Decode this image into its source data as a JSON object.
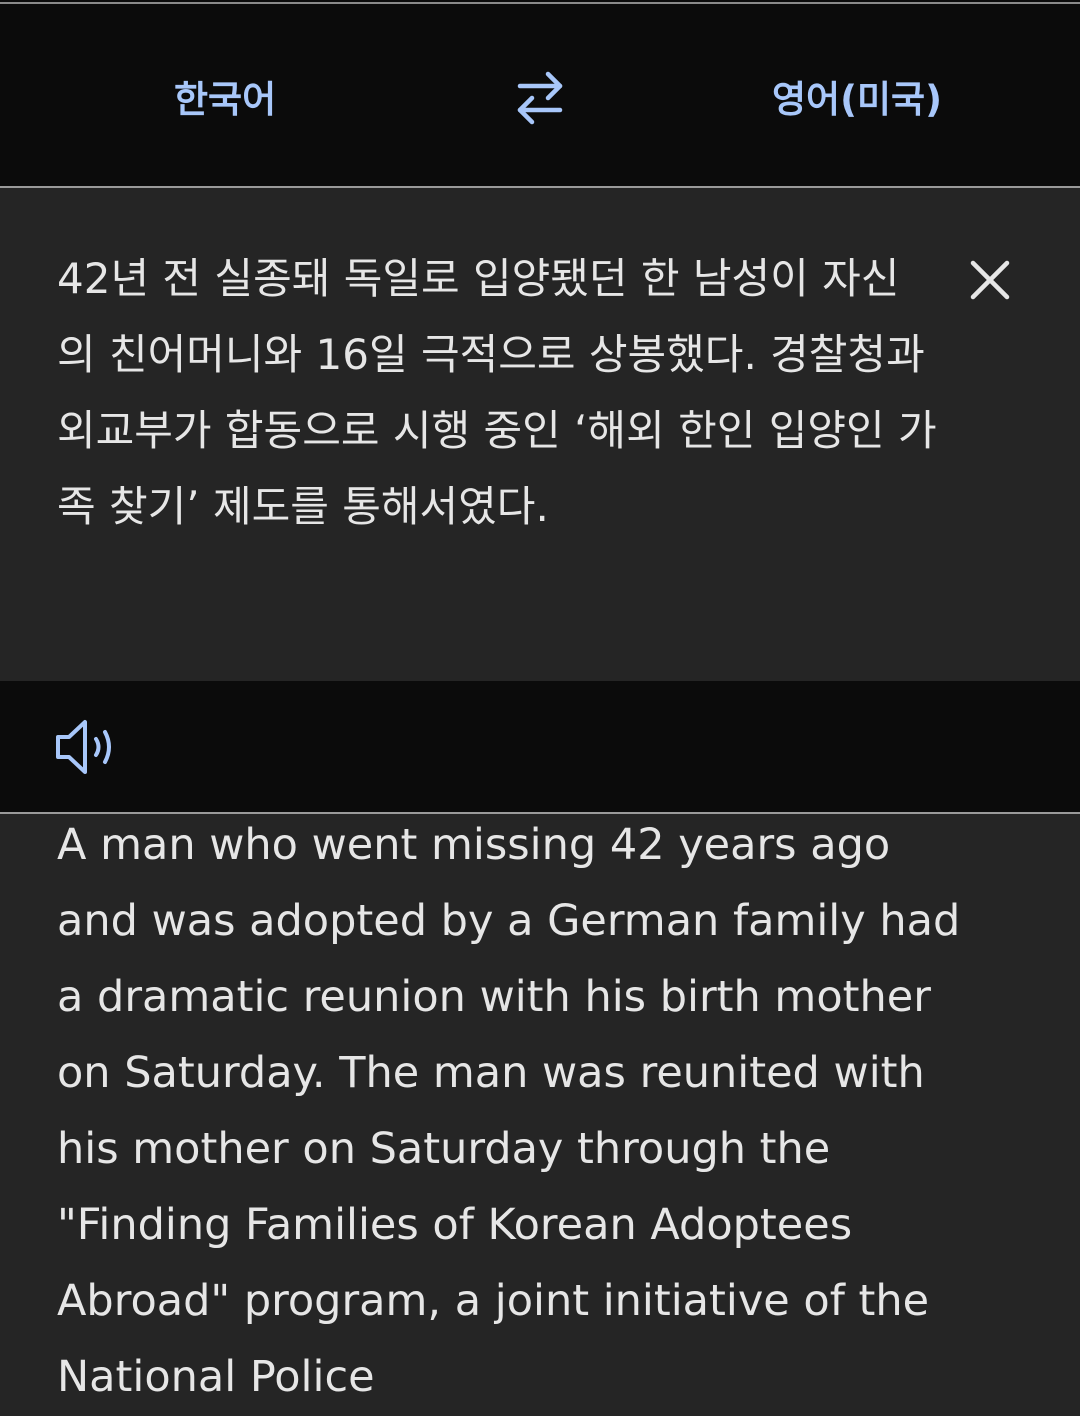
{
  "languages": {
    "source": "한국어",
    "target": "영어(미국)"
  },
  "icons": {
    "swap": "swap-arrows-icon",
    "close": "close-icon",
    "speaker": "speaker-icon"
  },
  "colors": {
    "accent": "#a8c7fa",
    "panel": "#252525",
    "background": "#0b0b0b",
    "text": "#e6e6e6"
  },
  "source_text": "42년 전 실종돼 독일로 입양됐던 한 남성이 자신의 친어머니와 16일 극적으로 상봉했다. 경찰청과 외교부가 합동으로 시행 중인 ‘해외 한인 입양인 가족 찾기’ 제도를 통해서였다.",
  "translation_text": "A man who went missing 42 years ago and was adopted by a German family had a dramatic reunion with his birth mother on Saturday. The man was reunited with his mother on Saturday through the \"Finding Families of Korean Adoptees Abroad\" program, a joint initiative of the National Police"
}
